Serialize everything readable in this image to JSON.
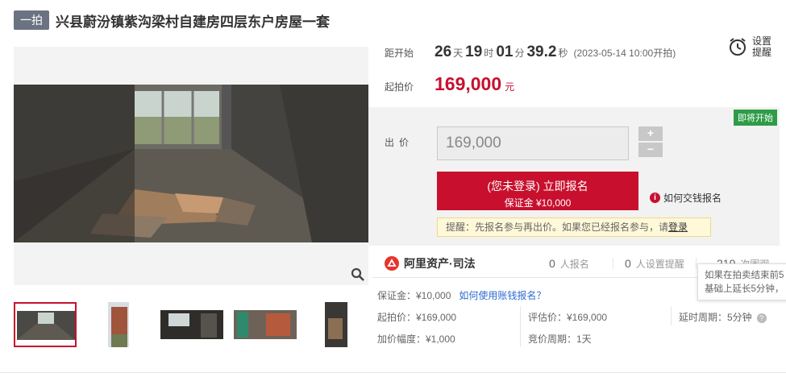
{
  "header": {
    "badge": "一拍",
    "title": "兴县蔚汾镇紫沟梁村自建房四层东户房屋一套"
  },
  "countdown": {
    "label": "距开始",
    "days": "26",
    "days_unit": "天",
    "hours": "19",
    "hours_unit": "时",
    "minutes": "01",
    "minutes_unit": "分",
    "seconds": "39.2",
    "seconds_unit": "秒",
    "start_note": "(2023-05-14 10:00开拍)"
  },
  "start_price": {
    "label": "起拍价",
    "value": "169,000",
    "unit": "元"
  },
  "reminder": {
    "line1": "设置",
    "line2": "提醒"
  },
  "bid": {
    "status_badge": "即将开始",
    "label": "出价",
    "value": "169,000",
    "plus": "+",
    "minus": "−",
    "register_main": "(您未登录) 立即报名",
    "register_sub": "保证金 ¥10,000",
    "how_pay": "如何交钱报名",
    "tip_prefix": "提醒：先报名参与再出价。如果您已经报名参与，请",
    "tip_link": "登录"
  },
  "platform": {
    "logo_text": "阿里资产·司法",
    "signup_count": "0",
    "signup_label": "人报名",
    "remind_count": "0",
    "remind_label": "人设置提醒",
    "views_count": "219",
    "views_label": "次围观"
  },
  "tooltip": {
    "line1": "如果在拍卖结束前5",
    "line2": "基础上延长5分钟，"
  },
  "details": {
    "deposit": "保证金：¥10,000",
    "deposit_link": "如何使用账钱报名？",
    "start_price": "起拍价：¥169,000",
    "appraisal": "评估价：¥169,000",
    "delay": "延时周期：5分钟",
    "increment": "加价幅度：¥1,000",
    "bid_cycle": "竞价周期：1天"
  },
  "colors": {
    "accent": "#c8102e",
    "soon": "#2e9c47",
    "link": "#2d6bd1"
  }
}
